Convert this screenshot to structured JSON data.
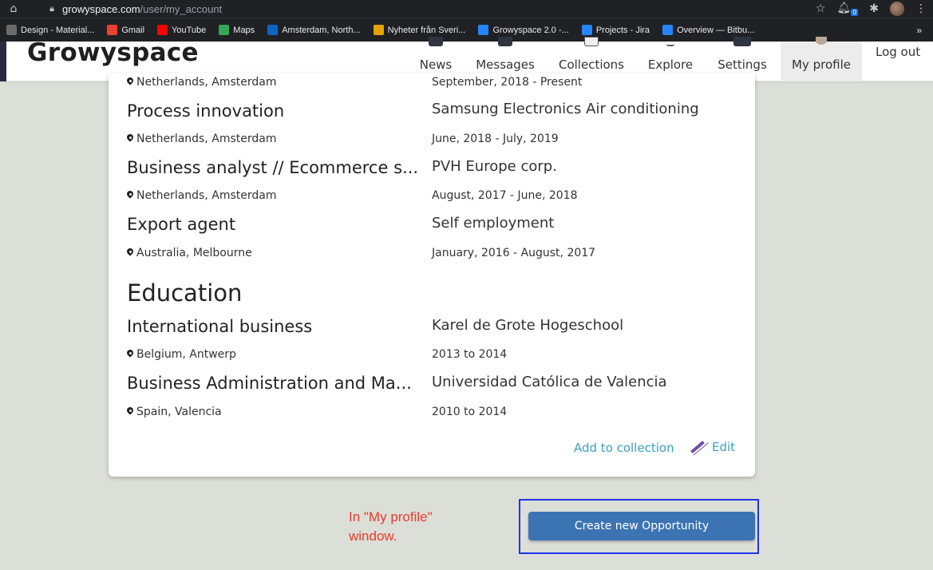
{
  "browser": {
    "url_host": "growyspace.com",
    "url_path": "/user/my_account",
    "notification_count": "0",
    "bookmarks": [
      {
        "label": "Design - Material...",
        "icon": "material-design-icon",
        "color": "#6b6b6b"
      },
      {
        "label": "Gmail",
        "icon": "gmail-icon",
        "color": "#ea4335"
      },
      {
        "label": "YouTube",
        "icon": "youtube-icon",
        "color": "#ff0000"
      },
      {
        "label": "Maps",
        "icon": "maps-icon",
        "color": "#34a853"
      },
      {
        "label": "Amsterdam, North...",
        "icon": "linkedin-icon",
        "color": "#0a66c2"
      },
      {
        "label": "Nyheter från Sveri...",
        "icon": "news-icon",
        "color": "#e6a200"
      },
      {
        "label": "Growyspace 2.0 -...",
        "icon": "jira-icon",
        "color": "#2684ff"
      },
      {
        "label": "Projects - Jira",
        "icon": "jira-diamond-icon",
        "color": "#2684ff"
      },
      {
        "label": "Overview — Bitbu...",
        "icon": "bitbucket-icon",
        "color": "#2684ff"
      }
    ],
    "bookmarks_more": "»"
  },
  "header": {
    "logo": "Growyspace",
    "nav": [
      {
        "label": "News"
      },
      {
        "label": "Messages"
      },
      {
        "label": "Collections"
      },
      {
        "label": "Explore"
      },
      {
        "label": "Settings"
      },
      {
        "label": "My profile",
        "active": true
      }
    ],
    "logout": "Log out"
  },
  "experience": [
    {
      "title": "",
      "org": "",
      "location": "Netherlands, Amsterdam",
      "dates": "September, 2018 - Present",
      "partial": true
    },
    {
      "title": "Process innovation",
      "org": "Samsung Electronics Air conditioning",
      "location": "Netherlands, Amsterdam",
      "dates": "June, 2018 - July, 2019"
    },
    {
      "title": "Business analyst // Ecommerce s...",
      "org": "PVH Europe corp.",
      "location": "Netherlands, Amsterdam",
      "dates": "August, 2017 - June, 2018"
    },
    {
      "title": "Export agent",
      "org": "Self employment",
      "location": "Australia, Melbourne",
      "dates": "January, 2016 - August, 2017"
    }
  ],
  "education": {
    "heading": "Education",
    "items": [
      {
        "title": "International business",
        "org": "Karel de Grote Hogeschool",
        "location": "Belgium, Antwerp",
        "dates": "2013 to 2014"
      },
      {
        "title": "Business Administration and Ma...",
        "org": "Universidad Católica de Valencia",
        "location": "Spain, Valencia",
        "dates": "2010 to 2014"
      }
    ]
  },
  "actions": {
    "add_to_collection": "Add to collection",
    "edit": "Edit"
  },
  "annotation": "In \"My profile\"\nwindow.",
  "cta": {
    "label": "Create new Opportunity"
  },
  "colors": {
    "link": "#3a9fc4",
    "cta": "#3c74b3",
    "annotation": "#ec3a2c",
    "highlight_box": "#1f35e6"
  }
}
